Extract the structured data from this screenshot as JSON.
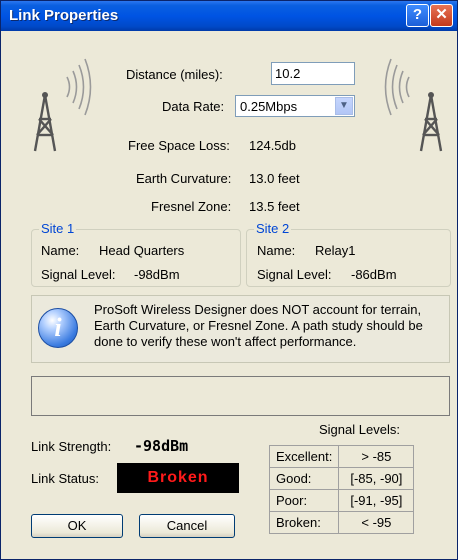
{
  "window": {
    "title": "Link Properties",
    "help_glyph": "?",
    "close_glyph": "✕"
  },
  "fields": {
    "distance_label": "Distance (miles):",
    "distance_value": "10.2",
    "data_rate_label": "Data Rate:",
    "data_rate_value": "0.25Mbps",
    "free_space_loss_label": "Free Space Loss:",
    "free_space_loss_value": "124.5db",
    "earth_curvature_label": "Earth Curvature:",
    "earth_curvature_value": "13.0 feet",
    "fresnel_zone_label": "Fresnel Zone:",
    "fresnel_zone_value": "13.5 feet"
  },
  "site1": {
    "title": "Site 1",
    "name_label": "Name:",
    "name": "Head Quarters",
    "signal_label": "Signal Level:",
    "signal": "-98dBm"
  },
  "site2": {
    "title": "Site 2",
    "name_label": "Name:",
    "name": "Relay1",
    "signal_label": "Signal Level:",
    "signal": "-86dBm"
  },
  "notice": {
    "text": "ProSoft Wireless Designer does NOT account for terrain, Earth Curvature, or Fresnel Zone.  A path study should be done to verify these won't affect performance."
  },
  "link": {
    "strength_label": "Link Strength:",
    "strength_value": "-98dBm",
    "status_label": "Link Status:",
    "status_value": "Broken"
  },
  "signal_levels": {
    "title": "Signal Levels:",
    "rows": [
      {
        "name": "Excellent:",
        "range": "> -85"
      },
      {
        "name": "Good:",
        "range": "[-85, -90]"
      },
      {
        "name": "Poor:",
        "range": "[-91, -95]"
      },
      {
        "name": "Broken:",
        "range": "< -95"
      }
    ]
  },
  "buttons": {
    "ok": "OK",
    "cancel": "Cancel"
  },
  "icons": {
    "left": "radio-tower-icon",
    "right": "radio-tower-icon",
    "notice": "info-icon"
  },
  "colors": {
    "title_bar": "#0054e3",
    "status_bg": "#000000",
    "status_text": "#ff1a1a",
    "group_title": "#0046d5"
  }
}
